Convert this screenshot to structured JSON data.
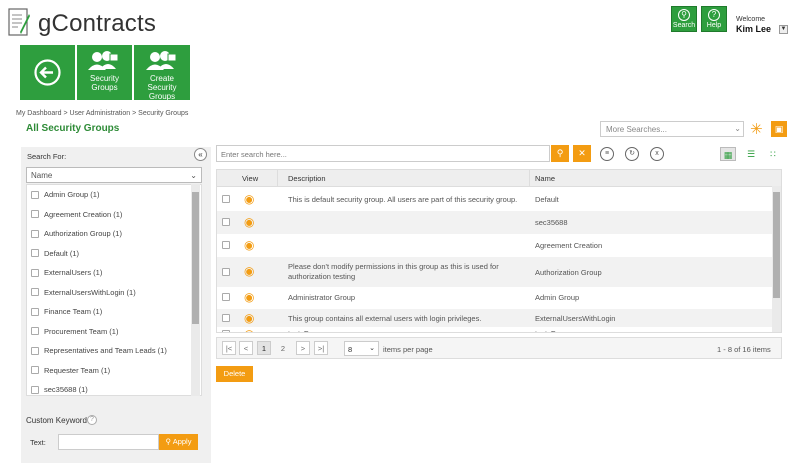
{
  "app": {
    "title": "gContracts"
  },
  "header": {
    "search_label": "Search",
    "help_label": "Help",
    "welcome": "Welcome",
    "user_name": "Kim Lee"
  },
  "tiles": {
    "security_groups": "Security Groups",
    "create_security_groups": "Create Security Groups"
  },
  "breadcrumb": "My Dashboard  >  User Administration  >  Security Groups",
  "page_title": "All Security Groups",
  "more_searches": {
    "placeholder": "More Searches..."
  },
  "left_panel": {
    "search_for": "Search For:",
    "field_select": "Name",
    "groups": [
      "Admin Group (1)",
      "Agreement Creation (1)",
      "Authorization Group (1)",
      "Default (1)",
      "ExternalUsers (1)",
      "ExternalUsersWithLogin (1)",
      "Finance Team (1)",
      "Procurement Team (1)",
      "Representatives and Team Leads (1)",
      "Requester Team (1)",
      "sec35688 (1)"
    ],
    "custom_keyword": "Custom Keyword",
    "text_label": "Text:",
    "apply": "Apply"
  },
  "search": {
    "placeholder": "Enter search here..."
  },
  "table": {
    "columns": {
      "view": "View",
      "description": "Description",
      "name": "Name"
    },
    "rows": [
      {
        "description": "This is default security group. All users are part of this security group.",
        "name": "Default"
      },
      {
        "description": "",
        "name": "sec35688"
      },
      {
        "description": "",
        "name": "Agreement Creation"
      },
      {
        "description": "Please don't modify permissions in this group as this is used for authorization testing",
        "name": "Authorization Group"
      },
      {
        "description": "Administrator Group",
        "name": "Admin Group"
      },
      {
        "description": "This group contains all external users with login privileges.",
        "name": "ExternalUsersWithLogin"
      },
      {
        "description": "testsFor",
        "name": "testsFor"
      }
    ]
  },
  "pager": {
    "pages": [
      "1",
      "2"
    ],
    "per_page": "8",
    "per_page_label": "items per page",
    "count": "1 - 8 of 16 items"
  },
  "delete_label": "Delete",
  "colors": {
    "brand_green": "#2e9e3e",
    "accent_orange": "#f39c12"
  }
}
